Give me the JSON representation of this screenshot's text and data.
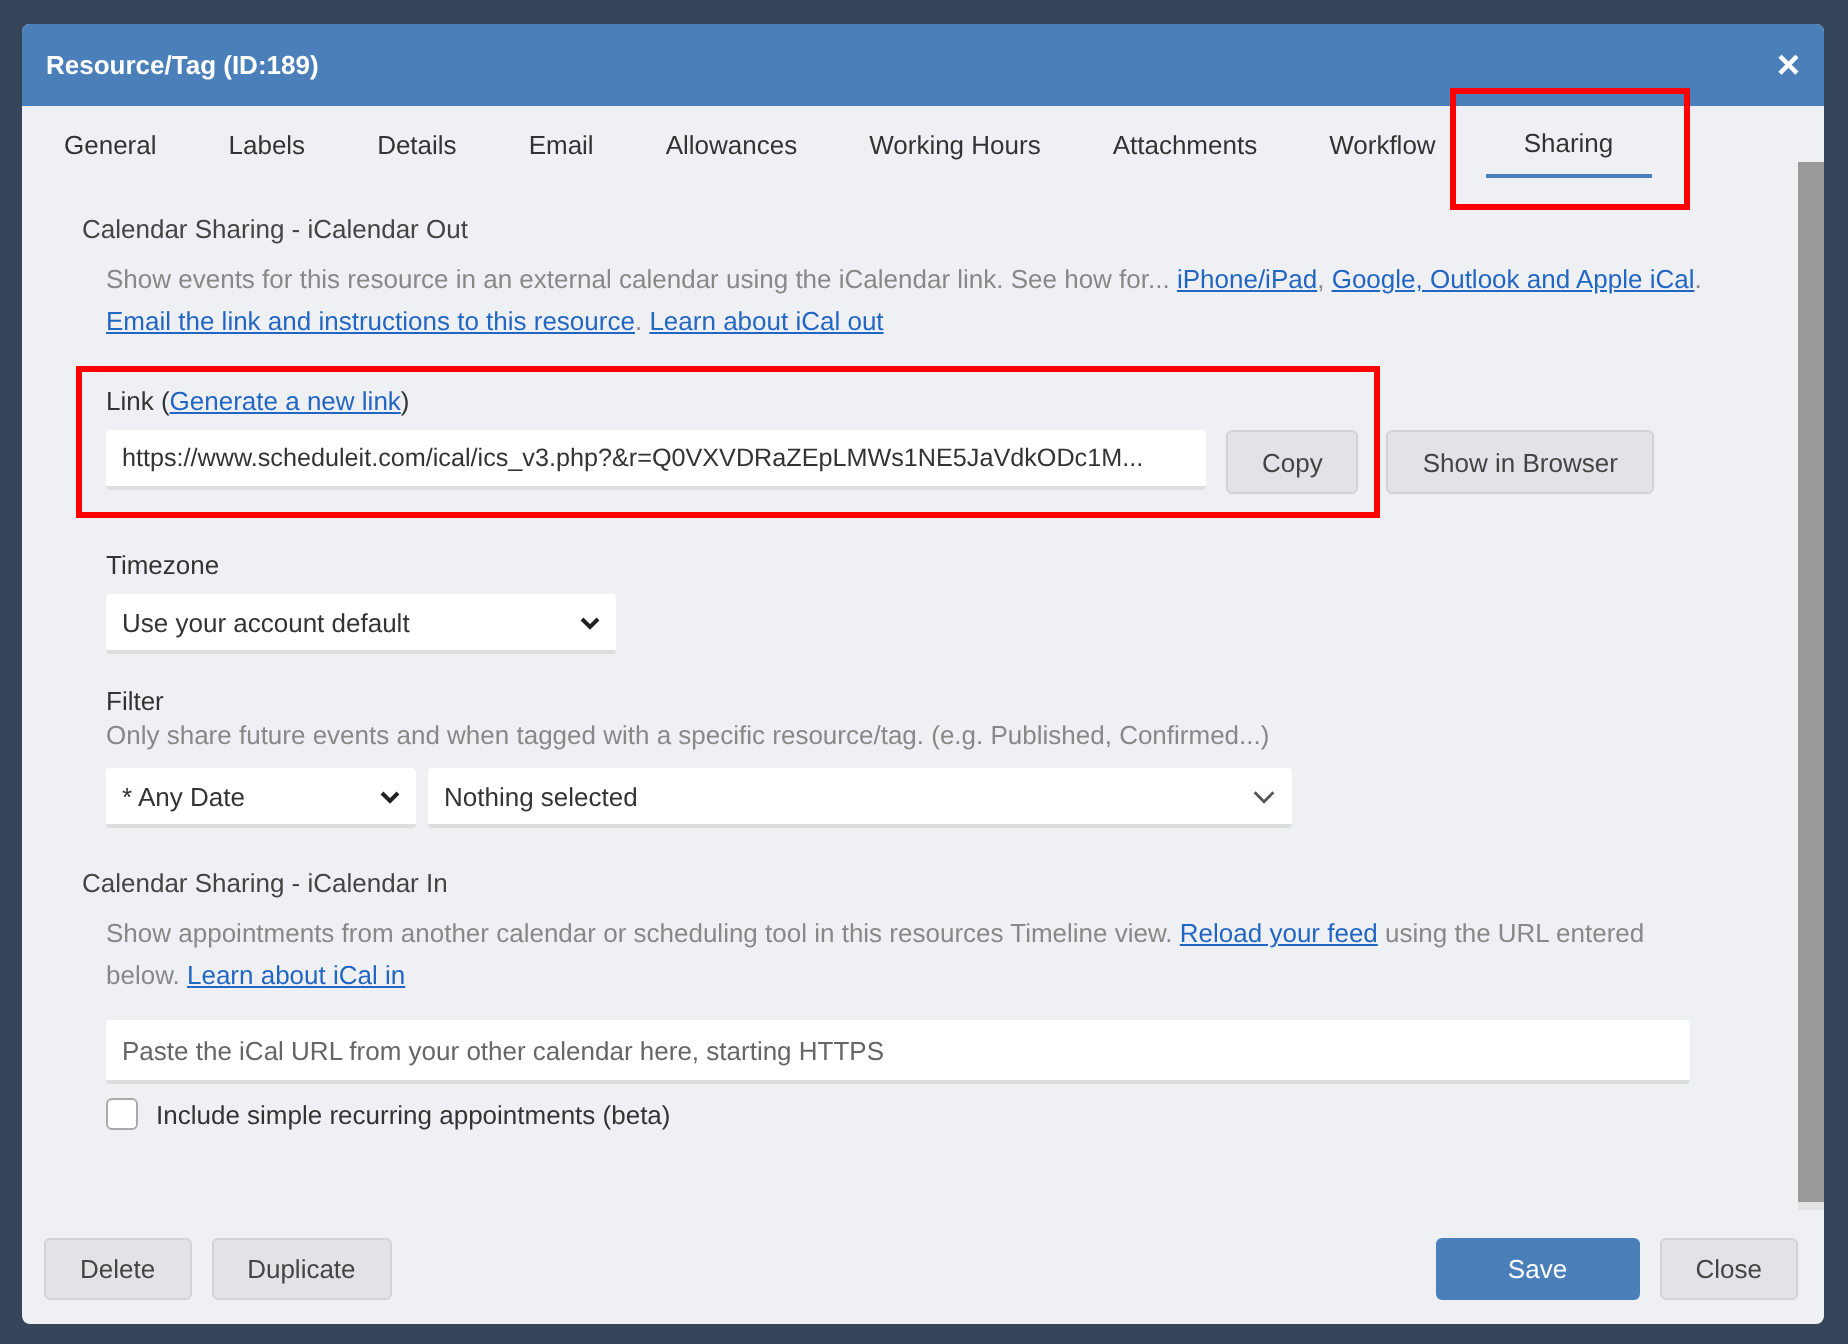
{
  "window": {
    "title": "Resource/Tag (ID:189)",
    "close": "×"
  },
  "tabs": [
    {
      "label": "General",
      "selected": false,
      "highlighted": false
    },
    {
      "label": "Labels",
      "selected": false,
      "highlighted": false
    },
    {
      "label": "Details",
      "selected": false,
      "highlighted": false
    },
    {
      "label": "Email",
      "selected": false,
      "highlighted": false
    },
    {
      "label": "Allowances",
      "selected": false,
      "highlighted": false
    },
    {
      "label": "Working Hours",
      "selected": false,
      "highlighted": false
    },
    {
      "label": "Attachments",
      "selected": false,
      "highlighted": false
    },
    {
      "label": "Workflow",
      "selected": false,
      "highlighted": false
    },
    {
      "label": "Sharing",
      "selected": true,
      "highlighted": true
    }
  ],
  "ical_out": {
    "heading": "Calendar Sharing - iCalendar Out",
    "description": [
      {
        "kind": "text",
        "text": "Show events for this resource in an external calendar using the iCalendar link. See how for... "
      },
      {
        "kind": "link",
        "text": "iPhone/iPad"
      },
      {
        "kind": "text",
        "text": ", "
      },
      {
        "kind": "link",
        "text": "Google, Outlook and Apple iCal"
      },
      {
        "kind": "text",
        "text": ". "
      },
      {
        "kind": "link",
        "text": "Email the link and instructions to this resource"
      },
      {
        "kind": "text",
        "text": ". "
      },
      {
        "kind": "link",
        "text": "Learn about iCal out"
      }
    ],
    "link": {
      "label": "Link (",
      "label_link": "Generate a new link",
      "label_close": ")",
      "value": "https://www.scheduleit.com/ical/ics_v3.php?&r=Q0VXVDRaZEpLMWs1NE5JaVdkODc1M...",
      "copy_button": "Copy",
      "highlighted": true
    },
    "show_button": "Show in Browser",
    "timezone": {
      "label": "Timezone",
      "value": "Use your account default"
    },
    "filter": {
      "label": "Filter",
      "hint": "Only share future events and when tagged with a specific resource/tag. (e.g. Published, Confirmed...)",
      "date": "* Any Date",
      "tags": "Nothing selected"
    }
  },
  "ical_in": {
    "heading": "Calendar Sharing - iCalendar In",
    "description": [
      {
        "kind": "text",
        "text": "Show appointments from another calendar or scheduling tool in this resources Timeline view. "
      },
      {
        "kind": "link",
        "text": "Reload your feed"
      },
      {
        "kind": "text",
        "text": " using the URL entered below. "
      },
      {
        "kind": "link",
        "text": "Learn about iCal in"
      }
    ],
    "url": {
      "placeholder": "Paste the iCal URL from your other calendar here, starting HTTPS"
    },
    "recurring": {
      "label": "Include simple recurring appointments (beta)",
      "checked": false
    }
  },
  "footer": {
    "left": [
      "Delete",
      "Duplicate"
    ],
    "save": "Save",
    "close": "Close"
  }
}
